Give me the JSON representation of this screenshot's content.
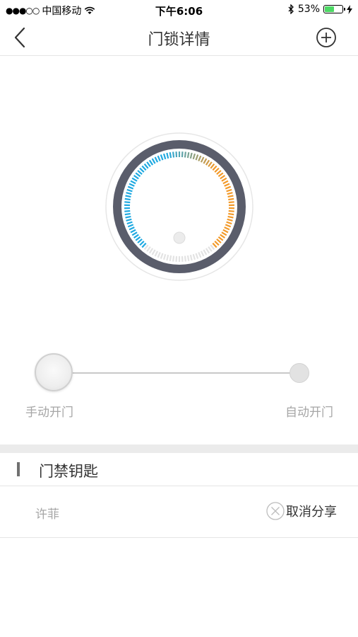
{
  "status_bar": {
    "carrier": "中国移动",
    "time": "下午6:06",
    "battery": "53%",
    "battery_level": 0.53
  },
  "nav": {
    "title": "门锁详情"
  },
  "slider": {
    "left_label": "手动开门",
    "right_label": "自动开门",
    "selected": "手动开门"
  },
  "section": {
    "title": "门禁钥匙"
  },
  "keys": [
    {
      "name": "许菲",
      "action_label": "取消分享"
    }
  ],
  "colors": {
    "blue": "#1fa9e1",
    "orange": "#f39a2a",
    "ring": "#5a5d6b"
  }
}
